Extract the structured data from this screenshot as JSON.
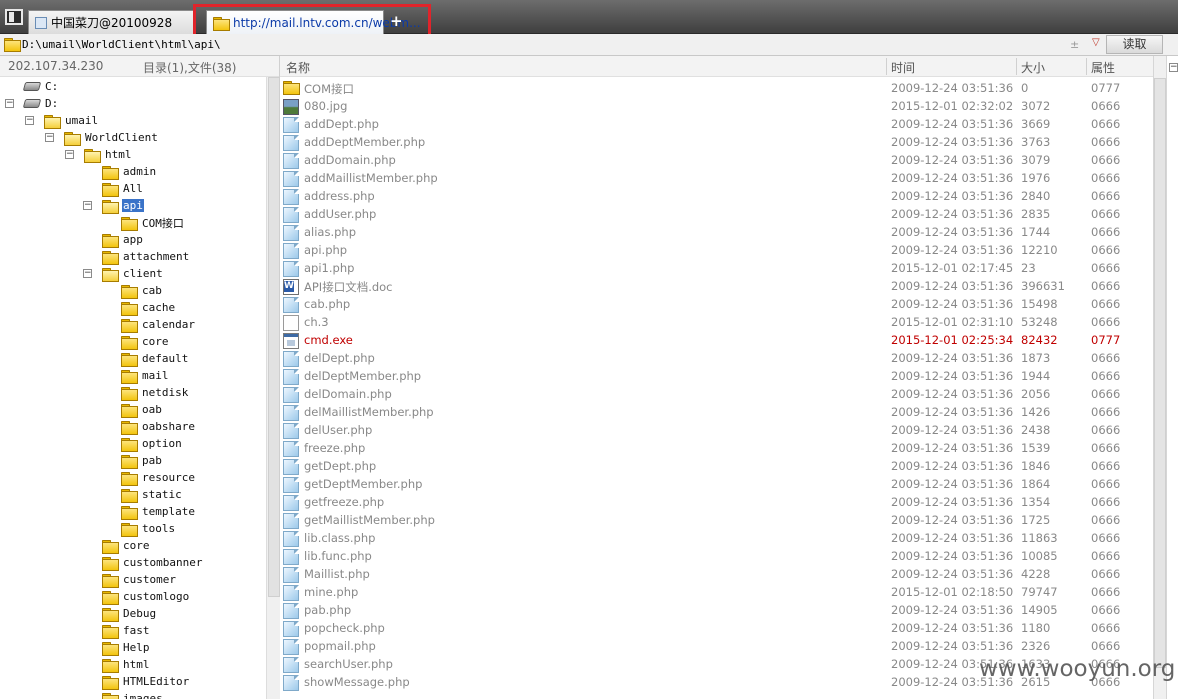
{
  "tabs": [
    {
      "label": "中国菜刀@20100928"
    },
    {
      "label": "http://mail.lntv.com.cn/webm..."
    }
  ],
  "tab_add": "+",
  "address": {
    "value": "D:\\umail\\WorldClient\\html\\api\\",
    "arrows": "± ",
    "drop": "▽",
    "read_button": "读取"
  },
  "left": {
    "ip": "202.107.34.230",
    "summary": "目录(1),文件(38)"
  },
  "tree": [
    {
      "label": "C:",
      "type": "drive",
      "level": 0,
      "toggle": ""
    },
    {
      "label": "D:",
      "type": "drive",
      "level": 0,
      "toggle": "−"
    },
    {
      "label": "umail",
      "level": 1,
      "toggle": "−"
    },
    {
      "label": "WorldClient",
      "level": 2,
      "toggle": "−"
    },
    {
      "label": "html",
      "level": 3,
      "toggle": "−"
    },
    {
      "label": "admin",
      "level": 4,
      "toggle": ""
    },
    {
      "label": "All",
      "level": 4,
      "toggle": ""
    },
    {
      "label": "api",
      "level": 4,
      "toggle": "−",
      "selected": true
    },
    {
      "label": "COM接口",
      "level": 5,
      "toggle": ""
    },
    {
      "label": "app",
      "level": 4,
      "toggle": ""
    },
    {
      "label": "attachment",
      "level": 4,
      "toggle": ""
    },
    {
      "label": "client",
      "level": 4,
      "toggle": "−"
    },
    {
      "label": "cab",
      "level": 5,
      "toggle": ""
    },
    {
      "label": "cache",
      "level": 5,
      "toggle": ""
    },
    {
      "label": "calendar",
      "level": 5,
      "toggle": ""
    },
    {
      "label": "core",
      "level": 5,
      "toggle": ""
    },
    {
      "label": "default",
      "level": 5,
      "toggle": ""
    },
    {
      "label": "mail",
      "level": 5,
      "toggle": ""
    },
    {
      "label": "netdisk",
      "level": 5,
      "toggle": ""
    },
    {
      "label": "oab",
      "level": 5,
      "toggle": ""
    },
    {
      "label": "oabshare",
      "level": 5,
      "toggle": ""
    },
    {
      "label": "option",
      "level": 5,
      "toggle": ""
    },
    {
      "label": "pab",
      "level": 5,
      "toggle": ""
    },
    {
      "label": "resource",
      "level": 5,
      "toggle": ""
    },
    {
      "label": "static",
      "level": 5,
      "toggle": ""
    },
    {
      "label": "template",
      "level": 5,
      "toggle": ""
    },
    {
      "label": "tools",
      "level": 5,
      "toggle": ""
    },
    {
      "label": "core",
      "level": 4,
      "toggle": ""
    },
    {
      "label": "custombanner",
      "level": 4,
      "toggle": ""
    },
    {
      "label": "customer",
      "level": 4,
      "toggle": ""
    },
    {
      "label": "customlogo",
      "level": 4,
      "toggle": ""
    },
    {
      "label": "Debug",
      "level": 4,
      "toggle": ""
    },
    {
      "label": "fast",
      "level": 4,
      "toggle": ""
    },
    {
      "label": "Help",
      "level": 4,
      "toggle": ""
    },
    {
      "label": "html",
      "level": 4,
      "toggle": ""
    },
    {
      "label": "HTMLEditor",
      "level": 4,
      "toggle": ""
    },
    {
      "label": "images",
      "level": 4,
      "toggle": ""
    }
  ],
  "columns": {
    "name": "名称",
    "time": "时间",
    "size": "大小",
    "attr": "属性"
  },
  "files": [
    {
      "name": "COM接口",
      "time": "2009-12-24 03:51:36",
      "size": "0",
      "attr": "0777",
      "icon": "folder"
    },
    {
      "name": "080.jpg",
      "time": "2015-12-01 02:32:02",
      "size": "3072",
      "attr": "0666",
      "icon": "img"
    },
    {
      "name": "addDept.php",
      "time": "2009-12-24 03:51:36",
      "size": "3669",
      "attr": "0666",
      "icon": "php"
    },
    {
      "name": "addDeptMember.php",
      "time": "2009-12-24 03:51:36",
      "size": "3763",
      "attr": "0666",
      "icon": "php"
    },
    {
      "name": "addDomain.php",
      "time": "2009-12-24 03:51:36",
      "size": "3079",
      "attr": "0666",
      "icon": "php"
    },
    {
      "name": "addMaillistMember.php",
      "time": "2009-12-24 03:51:36",
      "size": "1976",
      "attr": "0666",
      "icon": "php"
    },
    {
      "name": "address.php",
      "time": "2009-12-24 03:51:36",
      "size": "2840",
      "attr": "0666",
      "icon": "php"
    },
    {
      "name": "addUser.php",
      "time": "2009-12-24 03:51:36",
      "size": "2835",
      "attr": "0666",
      "icon": "php"
    },
    {
      "name": "alias.php",
      "time": "2009-12-24 03:51:36",
      "size": "1744",
      "attr": "0666",
      "icon": "php"
    },
    {
      "name": "api.php",
      "time": "2009-12-24 03:51:36",
      "size": "12210",
      "attr": "0666",
      "icon": "php"
    },
    {
      "name": "api1.php",
      "time": "2015-12-01 02:17:45",
      "size": "23",
      "attr": "0666",
      "icon": "php"
    },
    {
      "name": "API接口文档.doc",
      "time": "2009-12-24 03:51:36",
      "size": "396631",
      "attr": "0666",
      "icon": "doc"
    },
    {
      "name": "cab.php",
      "time": "2009-12-24 03:51:36",
      "size": "15498",
      "attr": "0666",
      "icon": "php"
    },
    {
      "name": "ch.3",
      "time": "2015-12-01 02:31:10",
      "size": "53248",
      "attr": "0666",
      "icon": "blank"
    },
    {
      "name": "cmd.exe",
      "time": "2015-12-01 02:25:34",
      "size": "82432",
      "attr": "0777",
      "icon": "exe",
      "red": true
    },
    {
      "name": "delDept.php",
      "time": "2009-12-24 03:51:36",
      "size": "1873",
      "attr": "0666",
      "icon": "php"
    },
    {
      "name": "delDeptMember.php",
      "time": "2009-12-24 03:51:36",
      "size": "1944",
      "attr": "0666",
      "icon": "php"
    },
    {
      "name": "delDomain.php",
      "time": "2009-12-24 03:51:36",
      "size": "2056",
      "attr": "0666",
      "icon": "php"
    },
    {
      "name": "delMaillistMember.php",
      "time": "2009-12-24 03:51:36",
      "size": "1426",
      "attr": "0666",
      "icon": "php"
    },
    {
      "name": "delUser.php",
      "time": "2009-12-24 03:51:36",
      "size": "2438",
      "attr": "0666",
      "icon": "php"
    },
    {
      "name": "freeze.php",
      "time": "2009-12-24 03:51:36",
      "size": "1539",
      "attr": "0666",
      "icon": "php"
    },
    {
      "name": "getDept.php",
      "time": "2009-12-24 03:51:36",
      "size": "1846",
      "attr": "0666",
      "icon": "php"
    },
    {
      "name": "getDeptMember.php",
      "time": "2009-12-24 03:51:36",
      "size": "1864",
      "attr": "0666",
      "icon": "php"
    },
    {
      "name": "getfreeze.php",
      "time": "2009-12-24 03:51:36",
      "size": "1354",
      "attr": "0666",
      "icon": "php"
    },
    {
      "name": "getMaillistMember.php",
      "time": "2009-12-24 03:51:36",
      "size": "1725",
      "attr": "0666",
      "icon": "php"
    },
    {
      "name": "lib.class.php",
      "time": "2009-12-24 03:51:36",
      "size": "11863",
      "attr": "0666",
      "icon": "php"
    },
    {
      "name": "lib.func.php",
      "time": "2009-12-24 03:51:36",
      "size": "10085",
      "attr": "0666",
      "icon": "php"
    },
    {
      "name": "Maillist.php",
      "time": "2009-12-24 03:51:36",
      "size": "4228",
      "attr": "0666",
      "icon": "php"
    },
    {
      "name": "mine.php",
      "time": "2015-12-01 02:18:50",
      "size": "79747",
      "attr": "0666",
      "icon": "php"
    },
    {
      "name": "pab.php",
      "time": "2009-12-24 03:51:36",
      "size": "14905",
      "attr": "0666",
      "icon": "php"
    },
    {
      "name": "popcheck.php",
      "time": "2009-12-24 03:51:36",
      "size": "1180",
      "attr": "0666",
      "icon": "php"
    },
    {
      "name": "popmail.php",
      "time": "2009-12-24 03:51:36",
      "size": "2326",
      "attr": "0666",
      "icon": "php"
    },
    {
      "name": "searchUser.php",
      "time": "2009-12-24 03:51:36",
      "size": "1633",
      "attr": "0666",
      "icon": "php"
    },
    {
      "name": "showMessage.php",
      "time": "2009-12-24 03:51:36",
      "size": "2615",
      "attr": "0666",
      "icon": "php"
    }
  ],
  "watermark": "www.wooyun.org",
  "colors": {
    "selection": "#3a73c8",
    "highlight_box": "#e0242b",
    "danger_row": "#c00000"
  }
}
